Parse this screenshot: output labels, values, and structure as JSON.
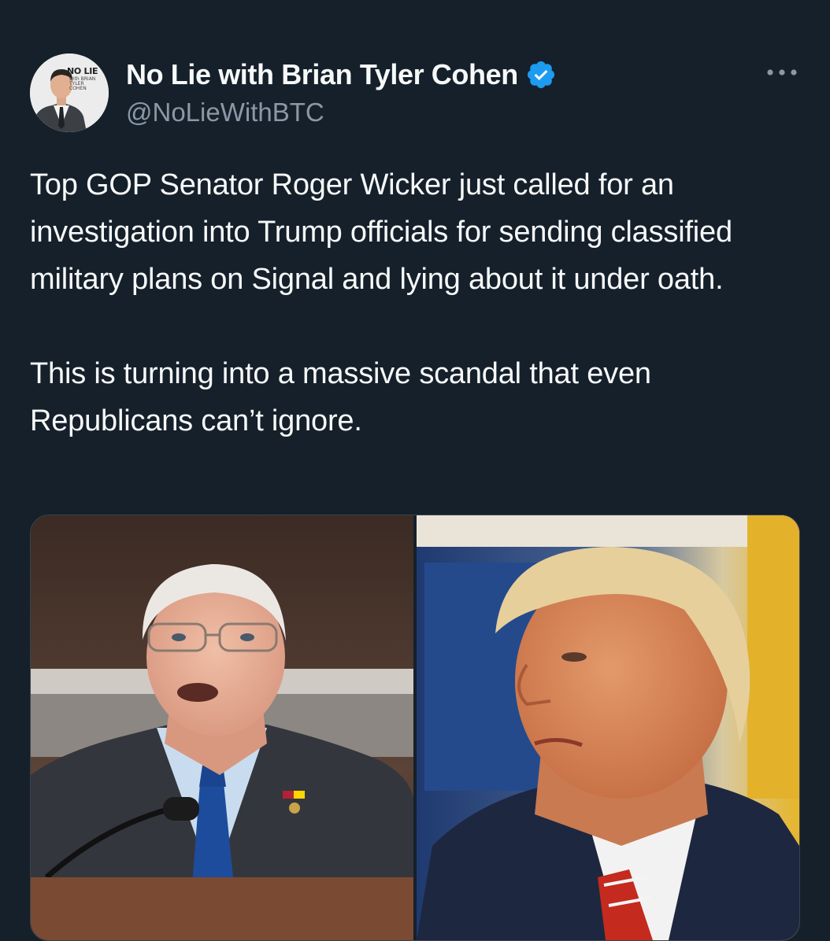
{
  "author": {
    "display_name": "No Lie with Brian Tyler Cohen",
    "handle": "@NoLieWithBTC",
    "verified": true,
    "avatar_logo_title": "NO LIE",
    "avatar_logo_sub": "with BRIAN TYLER COHEN"
  },
  "tweet": {
    "paragraphs": [
      "Top GOP Senator Roger Wicker just called for an investigation into Trump officials for sending classified military plans on Signal and lying about it under oath.",
      "This is turning into a massive scandal that even Republicans can’t ignore."
    ]
  },
  "media": {
    "count": 2,
    "photos": [
      "senator-photo",
      "trump-photo"
    ]
  },
  "icons": {
    "verified": "verified-badge-icon",
    "more": "more-horizontal-icon"
  },
  "colors": {
    "background": "#15202b",
    "text_primary": "#f7f9f9",
    "text_secondary": "#8b98a5",
    "verified_blue": "#1d9bf0",
    "border": "#38444d"
  }
}
